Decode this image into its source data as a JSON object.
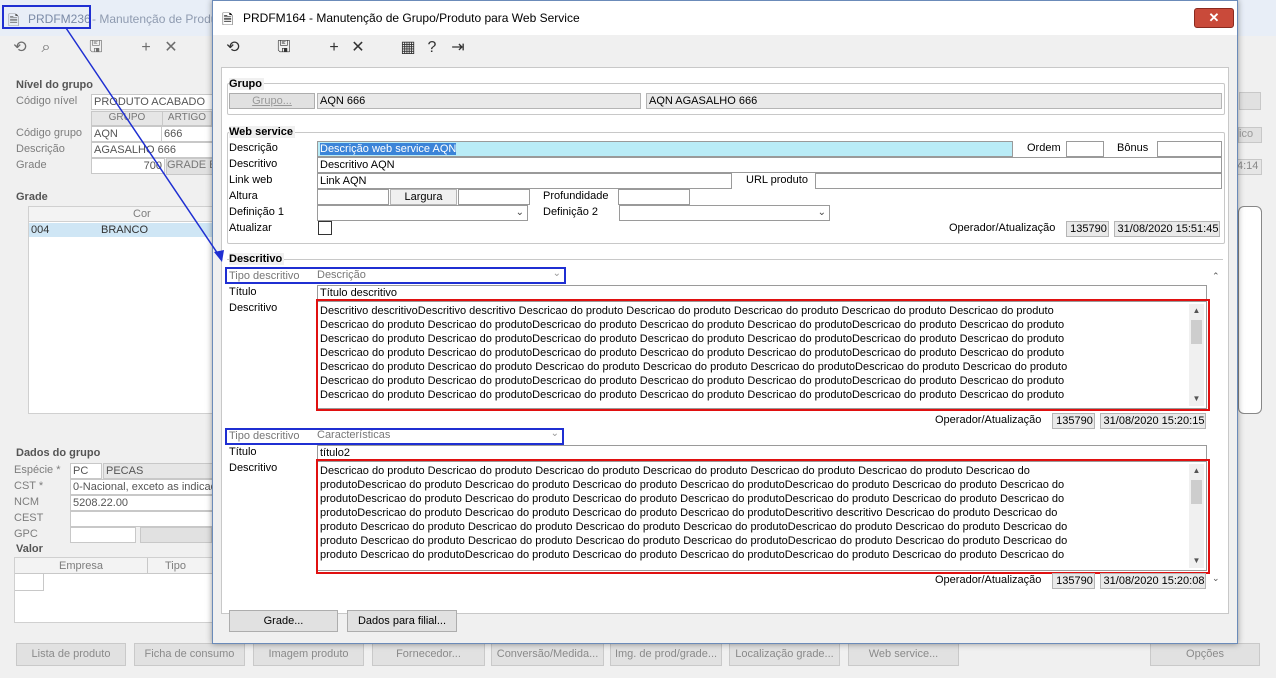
{
  "background_window": {
    "title_code": "PRDFM236",
    "title_rest": "- Manutenção de Produto",
    "nivel_group_title": "Nível do grupo",
    "codigo_nivel_label": "Código nível",
    "codigo_nivel_value": "PRODUTO ACABADO",
    "col_grupo": "GRUPO",
    "col_artigo": "ARTIGO",
    "codigo_grupo_label": "Código grupo",
    "codigo_grupo_value": "AQN",
    "codigo_grupo_artigo": "666",
    "descricao_label": "Descrição",
    "descricao_value": "AGASALHO 666",
    "grade_label": "Grade",
    "grade_value": "700",
    "grade_badge": "GRADE E",
    "grade_group_title": "Grade",
    "grade_col_cor": "Cor",
    "grade_row_code": "004",
    "grade_row_name": "BRANCO",
    "dados_group_title": "Dados do grupo",
    "especie_label": "Espécie *",
    "especie_code": "PC",
    "especie_name": "PECAS",
    "cst_label": "CST *",
    "cst_value": "0-Nacional, exceto as indicad",
    "ncm_label": "NCM",
    "ncm_value": "5208.22.00",
    "cest_label": "CEST",
    "gpc_label": "GPC",
    "valor_group_title": "Valor",
    "valor_col_empresa": "Empresa",
    "valor_col_tipo": "Tipo",
    "right_btn": "ico",
    "right_time": "4:14",
    "buttons": [
      "Lista de produto",
      "Ficha de consumo",
      "Imagem produto",
      "Fornecedor...",
      "Conversão/Medida...",
      "Img. de prod/grade...",
      "Localização grade...",
      "Web service...",
      "Opções"
    ]
  },
  "dialog": {
    "title": "PRDFM164 - Manutenção de Grupo/Produto para Web Service",
    "close_symbol": "✕",
    "grupo": {
      "section_title": "Grupo",
      "button_label": "Grupo...",
      "code": "AQN 666",
      "name": "AQN AGASALHO 666"
    },
    "web_service": {
      "section_title": "Web service",
      "descricao_label": "Descrição",
      "descricao_value": "Descrição web service AQN",
      "ordem_label": "Ordem",
      "bonus_label": "Bônus",
      "descritivo_label": "Descritivo",
      "descritivo_value": "Descritivo AQN",
      "link_web_label": "Link web",
      "link_web_value": "Link AQN",
      "url_produto_label": "URL produto",
      "altura_label": "Altura",
      "largura_label": "Largura",
      "profundidade_label": "Profundidade",
      "definicao1_label": "Definição 1",
      "definicao2_label": "Definição 2",
      "atualizar_label": "Atualizar",
      "operador_label": "Operador/Atualização",
      "operador_code": "135790",
      "operador_date": "31/08/2020 15:51:45"
    },
    "descritivo": {
      "section_title": "Descritivo",
      "blocks": [
        {
          "tipo_label": "Tipo descritivo",
          "tipo_value": "Descrição",
          "titulo_label": "Título",
          "titulo_value": "Título descritivo",
          "descritivo_label": "Descritivo",
          "lines": [
            "Descritivo descritivoDescritivo descritivo Descricao do produto Descricao do produto Descricao do produto Descricao do produto Descricao do produto",
            "Descricao do produto Descricao do produtoDescricao do produto Descricao do produto Descricao do produtoDescricao do produto Descricao do produto",
            "Descricao do produto Descricao do produtoDescricao do produto Descricao do produto Descricao do produtoDescricao do produto Descricao do produto",
            "Descricao do produto Descricao do produtoDescricao do produto Descricao do produto Descricao do produtoDescricao do produto Descricao do produto",
            "Descricao do produto Descricao do produto Descricao do produto Descricao do produto Descricao do produtoDescricao do produto Descricao do produto",
            "Descricao do produto Descricao do produtoDescricao do produto Descricao do produto Descricao do produtoDescricao do produto Descricao do produto",
            "Descricao do produto Descricao do produtoDescricao do produto Descricao do produto Descricao do produtoDescricao do produto Descricao do produto"
          ],
          "operador_label": "Operador/Atualização",
          "operador_code": "135790",
          "operador_date": "31/08/2020 15:20:15"
        },
        {
          "tipo_label": "Tipo descritivo",
          "tipo_value": "Características",
          "titulo_label": "Título",
          "titulo_value": "título2",
          "descritivo_label": "Descritivo",
          "lines": [
            "Descricao do produto Descricao do produto Descricao do produto Descricao do produto Descricao do produto Descricao do produto Descricao do",
            "produtoDescricao do produto Descricao do produto Descricao do produto Descricao do produtoDescricao do produto Descricao do produto Descricao do",
            "produtoDescricao do produto Descricao do produto Descricao do produto Descricao do produtoDescricao do produto Descricao do produto Descricao do",
            "produtoDescricao do produto Descricao do produto Descricao do produto Descricao do produtoDescritivo descritivo Descricao do produto Descricao do",
            "produto Descricao do produto Descricao do produto Descricao do produto Descricao do produtoDescricao do produto Descricao do produto Descricao do",
            "produto Descricao do produto Descricao do produto Descricao do produto Descricao do produtoDescricao do produto Descricao do produto Descricao do",
            "produto Descricao do produtoDescricao do produto Descricao do produto Descricao do produtoDescricao do produto Descricao do produto Descricao do"
          ],
          "operador_label": "Operador/Atualização",
          "operador_code": "135790",
          "operador_date": "31/08/2020 15:20:08"
        }
      ]
    },
    "footer": {
      "grade_button": "Grade...",
      "dados_filial_button": "Dados para filial..."
    }
  },
  "annotations": {
    "highlight_red": "#e01010",
    "highlight_blue": "#1f2fd2"
  }
}
